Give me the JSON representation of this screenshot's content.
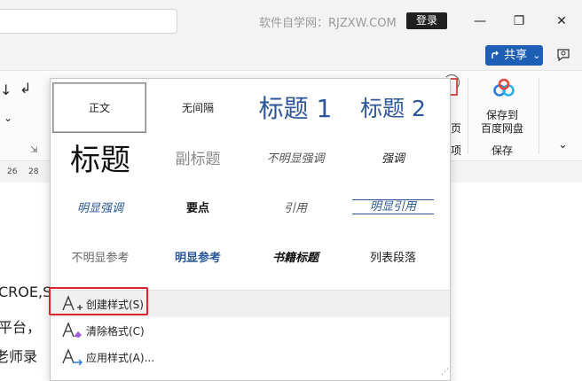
{
  "titlebar": {
    "watermark": "软件自学网：RJZXW.COM",
    "login_label": "登录",
    "minimize_glyph": "—",
    "restore_glyph": "❐",
    "close_glyph": "✕"
  },
  "ribbon": {
    "share_label": "共享",
    "share_chevron": "⌄",
    "save_to_label_line1": "保存到",
    "save_to_label_line2": "百度网盘",
    "save_group_label": "保存",
    "partial_label_1": "页",
    "partial_label_2": "项",
    "collapse_chevron": "⌄",
    "dialog_launcher": "⇲",
    "left_sort_glyph": "↓",
    "left_return_glyph": "↲",
    "left_chevron": "⌄"
  },
  "ruler": {
    "ticks": [
      "26",
      "28"
    ]
  },
  "document": {
    "lines": [
      "CROE,S",
      "平台，",
      "老师录"
    ]
  },
  "gallery": {
    "styles": [
      {
        "label": "正文"
      },
      {
        "label": "无间隔"
      },
      {
        "label": "标题 1"
      },
      {
        "label": "标题 2"
      },
      {
        "label": "标题"
      },
      {
        "label": "副标题"
      },
      {
        "label": "不明显强调"
      },
      {
        "label": "强调"
      },
      {
        "label": "明显强调"
      },
      {
        "label": "要点"
      },
      {
        "label": "引用"
      },
      {
        "label": "明显引用"
      },
      {
        "label": "不明显参考"
      },
      {
        "label": "明显参考"
      },
      {
        "label": "书籍标题"
      },
      {
        "label": "列表段落"
      }
    ],
    "commands": {
      "create": "创建样式(S)",
      "clear": "清除格式(C)",
      "apply": "应用样式(A)..."
    },
    "resize_grip": "⋰"
  },
  "colors": {
    "accent_blue": "#2b579a",
    "share_blue": "#1c5fb5",
    "highlight_red": "#d9262c"
  }
}
